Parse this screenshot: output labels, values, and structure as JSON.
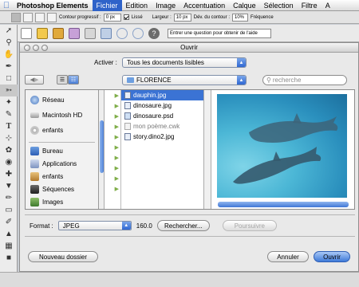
{
  "menubar": {
    "app": "Photoshop Elements",
    "items": [
      "Fichier",
      "Edition",
      "Image",
      "Accentuation",
      "Calque",
      "Sélection",
      "Filtre",
      "A"
    ],
    "active": "Fichier"
  },
  "options": {
    "contour_label": "Contour progressif :",
    "contour_value": "0 px",
    "lisse_label": "Lissé",
    "largeur_label": "Largeur :",
    "largeur_value": "10 px",
    "dev_label": "Dév. du contour :",
    "dev_value": "10%",
    "freq_label": "Fréquence"
  },
  "shortcuts": {
    "question_placeholder": "Entrer une question pour obtenir de l'aide"
  },
  "dialog": {
    "title": "Ouvrir",
    "show_label": "Activer :",
    "show_value": "Tous les documents lisibles",
    "location": "FLORENCE",
    "search_placeholder": "recherche",
    "sidebar": {
      "devices": [
        "Réseau",
        "Macintosh HD",
        "enfants"
      ],
      "places": [
        "Bureau",
        "Applications",
        "enfants",
        "Séquences",
        "Images"
      ]
    },
    "files": [
      {
        "name": "dauphin.jpg",
        "selected": true
      },
      {
        "name": "dinosaure.jpg",
        "selected": false
      },
      {
        "name": "dinosaure.psd",
        "selected": false
      },
      {
        "name": "mon poème.cwk",
        "selected": false,
        "dimmed": true
      },
      {
        "name": "story.dino2.jpg",
        "selected": false
      }
    ],
    "format_label": "Format :",
    "format_value": "JPEG",
    "format_size": "160.0",
    "find_button": "Rechercher...",
    "find_next_button": "Poursuivre",
    "new_folder_button": "Nouveau dossier",
    "cancel_button": "Annuler",
    "open_button": "Ouvrir"
  },
  "colors": {
    "selection": "#3b73d4",
    "accent": "#2f63c9",
    "water": "#2a8fbd"
  }
}
